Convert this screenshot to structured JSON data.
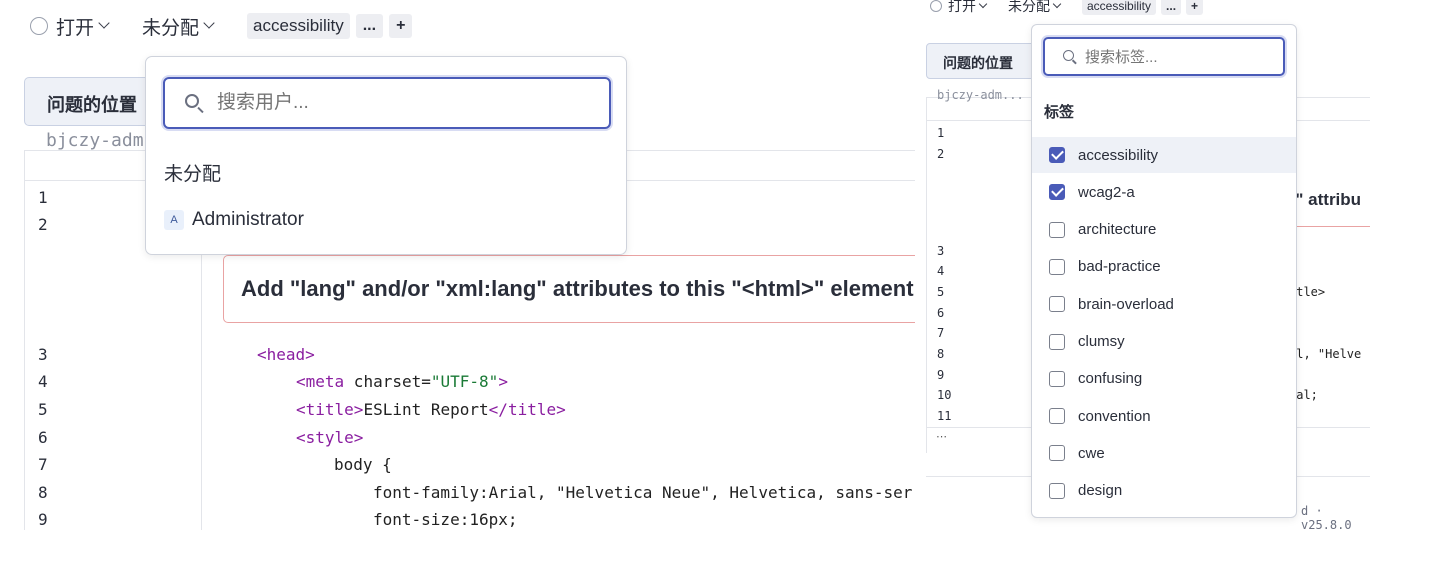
{
  "left": {
    "status": "打开",
    "assignee": "未分配",
    "tag": "accessibility",
    "more": "...",
    "add": "+",
    "location_button": "问题的位置",
    "code_header": "bjczy-adm...",
    "issue_message": "Add \"lang\" and/or \"xml:lang\" attributes to this \"<html>\" element",
    "line_numbers": [
      "1",
      "2",
      "3",
      "4",
      "5",
      "6",
      "7",
      "8",
      "9"
    ],
    "code": {
      "l3": "<head>",
      "l4a": "<meta",
      "l4b": " charset=",
      "l4c": "\"UTF-8\"",
      "l4d": ">",
      "l5a": "<title>",
      "l5b": "ESLint Report",
      "l5c": "</title>",
      "l6": "<style>",
      "l7": "body {",
      "l8": "font-family:Arial, \"Helvetica Neue\", Helvetica, sans-ser",
      "l9": "font-size:16px;"
    },
    "assignee_dropdown": {
      "placeholder": "搜索用户...",
      "unassigned": "未分配",
      "avatar_letter": "A",
      "user": "Administrator"
    }
  },
  "right": {
    "status": "打开",
    "assignee": "未分配",
    "tag": "accessibility",
    "more": "...",
    "add": "+",
    "location_button": "问题的位置",
    "code_header": "bjczy-adm...",
    "line_numbers": [
      "1",
      "2",
      "3",
      "4",
      "5",
      "6",
      "7",
      "8",
      "9",
      "10",
      "11"
    ],
    "issue_fragment": "g\" attribu",
    "code_fragments": {
      "l5": "itle>",
      "l8": "al, \"Helve",
      "l10": "mal;"
    },
    "expand": "⋯",
    "version": "d · v25.8.0",
    "labels_dropdown": {
      "placeholder": "搜索标签...",
      "header": "标签",
      "items": [
        {
          "label": "accessibility",
          "checked": true
        },
        {
          "label": "wcag2-a",
          "checked": true
        },
        {
          "label": "architecture",
          "checked": false
        },
        {
          "label": "bad-practice",
          "checked": false
        },
        {
          "label": "brain-overload",
          "checked": false
        },
        {
          "label": "clumsy",
          "checked": false
        },
        {
          "label": "confusing",
          "checked": false
        },
        {
          "label": "convention",
          "checked": false
        },
        {
          "label": "cwe",
          "checked": false
        },
        {
          "label": "design",
          "checked": false
        }
      ]
    }
  }
}
